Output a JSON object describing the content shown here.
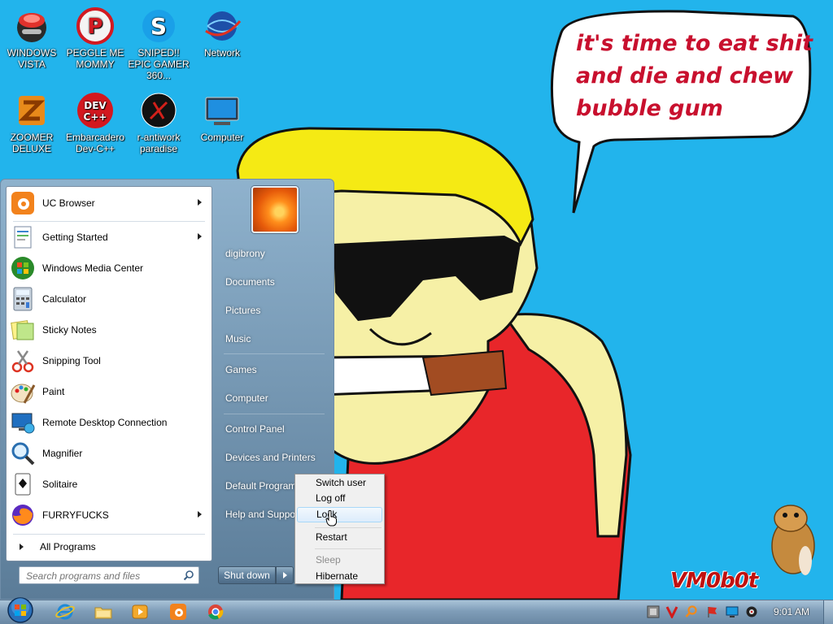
{
  "wallpaper": {
    "speech_bubble": [
      "it's time to eat shit",
      "and die and chew",
      "bubble gum"
    ],
    "watermark": "VM0b0t"
  },
  "desktop_icons": [
    {
      "label": "WINDOWS VISTA",
      "icon": "windows-vista-icon"
    },
    {
      "label": "PEGGLE ME MOMMY",
      "icon": "peggle-icon"
    },
    {
      "label": "SNIPED!! EPIC GAMER 360...",
      "icon": "skype-icon"
    },
    {
      "label": "Network",
      "icon": "network-icon"
    },
    {
      "label": "ZOOMER DELUXE",
      "icon": "zoomer-icon"
    },
    {
      "label": "Embarcadero Dev-C++",
      "icon": "dev-cpp-icon"
    },
    {
      "label": "r-antiwork paradise",
      "icon": "r-antiwork-icon"
    },
    {
      "label": "Computer",
      "icon": "computer-icon"
    }
  ],
  "start_menu": {
    "programs": [
      {
        "label": "UC Browser",
        "icon": "uc-browser-icon",
        "submenu": true
      },
      {
        "label": "Getting Started",
        "icon": "getting-started-icon",
        "submenu": true
      },
      {
        "label": "Windows Media Center",
        "icon": "media-center-icon",
        "submenu": false
      },
      {
        "label": "Calculator",
        "icon": "calculator-icon",
        "submenu": false
      },
      {
        "label": "Sticky Notes",
        "icon": "sticky-notes-icon",
        "submenu": false
      },
      {
        "label": "Snipping Tool",
        "icon": "snipping-tool-icon",
        "submenu": false
      },
      {
        "label": "Paint",
        "icon": "paint-icon",
        "submenu": false
      },
      {
        "label": "Remote Desktop Connection",
        "icon": "remote-desktop-icon",
        "submenu": false
      },
      {
        "label": "Magnifier",
        "icon": "magnifier-icon",
        "submenu": false
      },
      {
        "label": "Solitaire",
        "icon": "solitaire-icon",
        "submenu": false
      },
      {
        "label": "FURRYFUCKS",
        "icon": "firefox-icon",
        "submenu": true
      }
    ],
    "all_programs": "All Programs",
    "search_placeholder": "Search programs and files",
    "right_links": [
      "digibrony",
      "Documents",
      "Pictures",
      "Music",
      "Games",
      "Computer",
      "Control Panel",
      "Devices and Printers",
      "Default Programs",
      "Help and Support"
    ],
    "shutdown_label": "Shut down"
  },
  "power_menu": {
    "items": [
      {
        "label": "Switch user",
        "enabled": true,
        "highlighted": false
      },
      {
        "label": "Log off",
        "enabled": true,
        "highlighted": false
      },
      {
        "label": "Lock",
        "enabled": true,
        "highlighted": true
      },
      {
        "label": "Restart",
        "enabled": true,
        "highlighted": false
      },
      {
        "label": "Sleep",
        "enabled": false,
        "highlighted": false
      },
      {
        "label": "Hibernate",
        "enabled": true,
        "highlighted": false
      }
    ]
  },
  "taskbar": {
    "pinned": [
      "internet-explorer-icon",
      "explorer-folder-icon",
      "media-player-icon",
      "uc-browser-icon",
      "chrome-icon"
    ],
    "tray": [
      "tray-app-icon",
      "tray-v-icon",
      "tray-search-icon",
      "action-center-flag-icon",
      "display-icon",
      "volume-icon"
    ],
    "clock": "9:01 AM"
  },
  "colors": {
    "desktop": "#22b4ec",
    "bubble_text": "#c8102e",
    "taskbar": "#7f9db8",
    "highlight": "#dcecfc"
  }
}
